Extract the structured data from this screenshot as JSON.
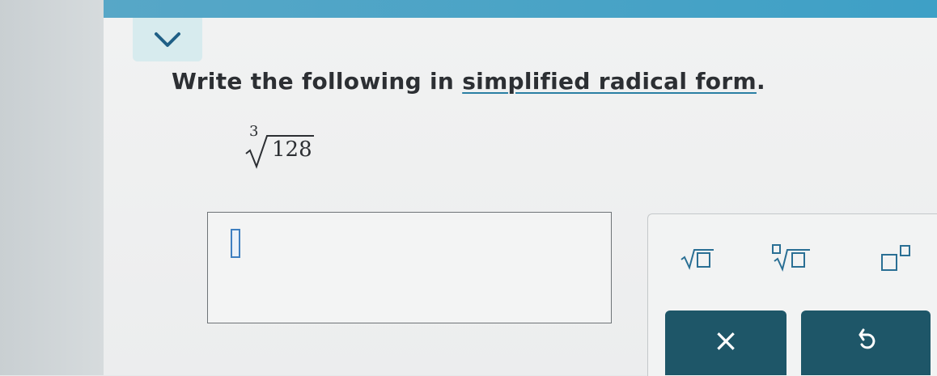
{
  "header": {
    "collapse_icon": "chevron-down-icon",
    "accent_color": "#3ea0c6"
  },
  "question": {
    "prompt_prefix": "Write the following in ",
    "prompt_link": "simplified radical form",
    "prompt_suffix": ".",
    "expression": {
      "index": "3",
      "radicand": "128"
    }
  },
  "answer": {
    "value": ""
  },
  "palette": {
    "tools": [
      {
        "name": "square-root",
        "icon": "sqrt-template-icon"
      },
      {
        "name": "nth-root",
        "icon": "nth-root-template-icon"
      },
      {
        "name": "exponent",
        "icon": "superscript-template-icon"
      }
    ],
    "clear_label": "×",
    "undo_icon": "undo-icon",
    "button_color": "#1e5668"
  }
}
